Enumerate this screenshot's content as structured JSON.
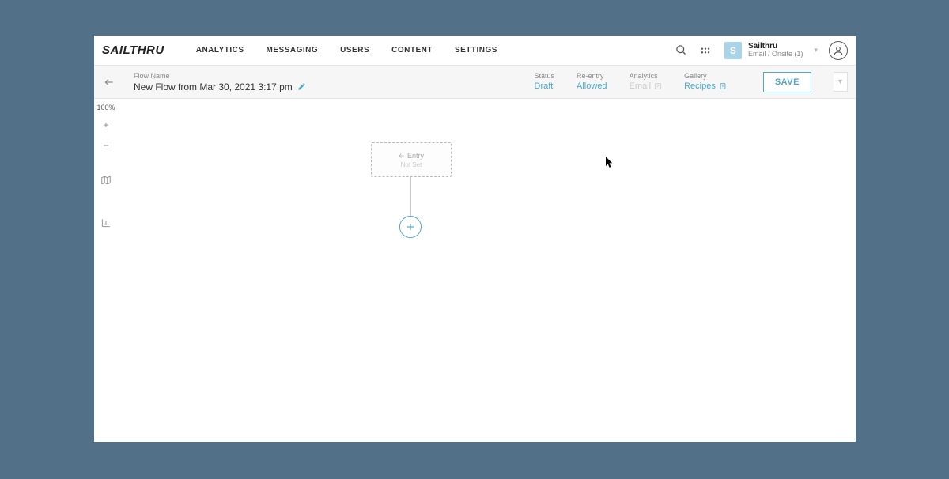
{
  "brand": "SAILTHRU",
  "nav": {
    "analytics": "ANALYTICS",
    "messaging": "MESSAGING",
    "users": "USERS",
    "content": "CONTENT",
    "settings": "SETTINGS"
  },
  "account": {
    "initial": "S",
    "name": "Sailthru",
    "sub": "Email / Onsite (1)"
  },
  "subheader": {
    "flow_name_label": "Flow Name",
    "flow_name": "New Flow from Mar 30, 2021 3:17 pm",
    "status_label": "Status",
    "status_value": "Draft",
    "reentry_label": "Re-entry",
    "reentry_value": "Allowed",
    "analytics_label": "Analytics",
    "analytics_value": "Email",
    "gallery_label": "Gallery",
    "gallery_value": "Recipes",
    "save": "SAVE"
  },
  "rail": {
    "zoom": "100%"
  },
  "canvas": {
    "entry_label": "Entry",
    "entry_sub": "Not Set"
  }
}
